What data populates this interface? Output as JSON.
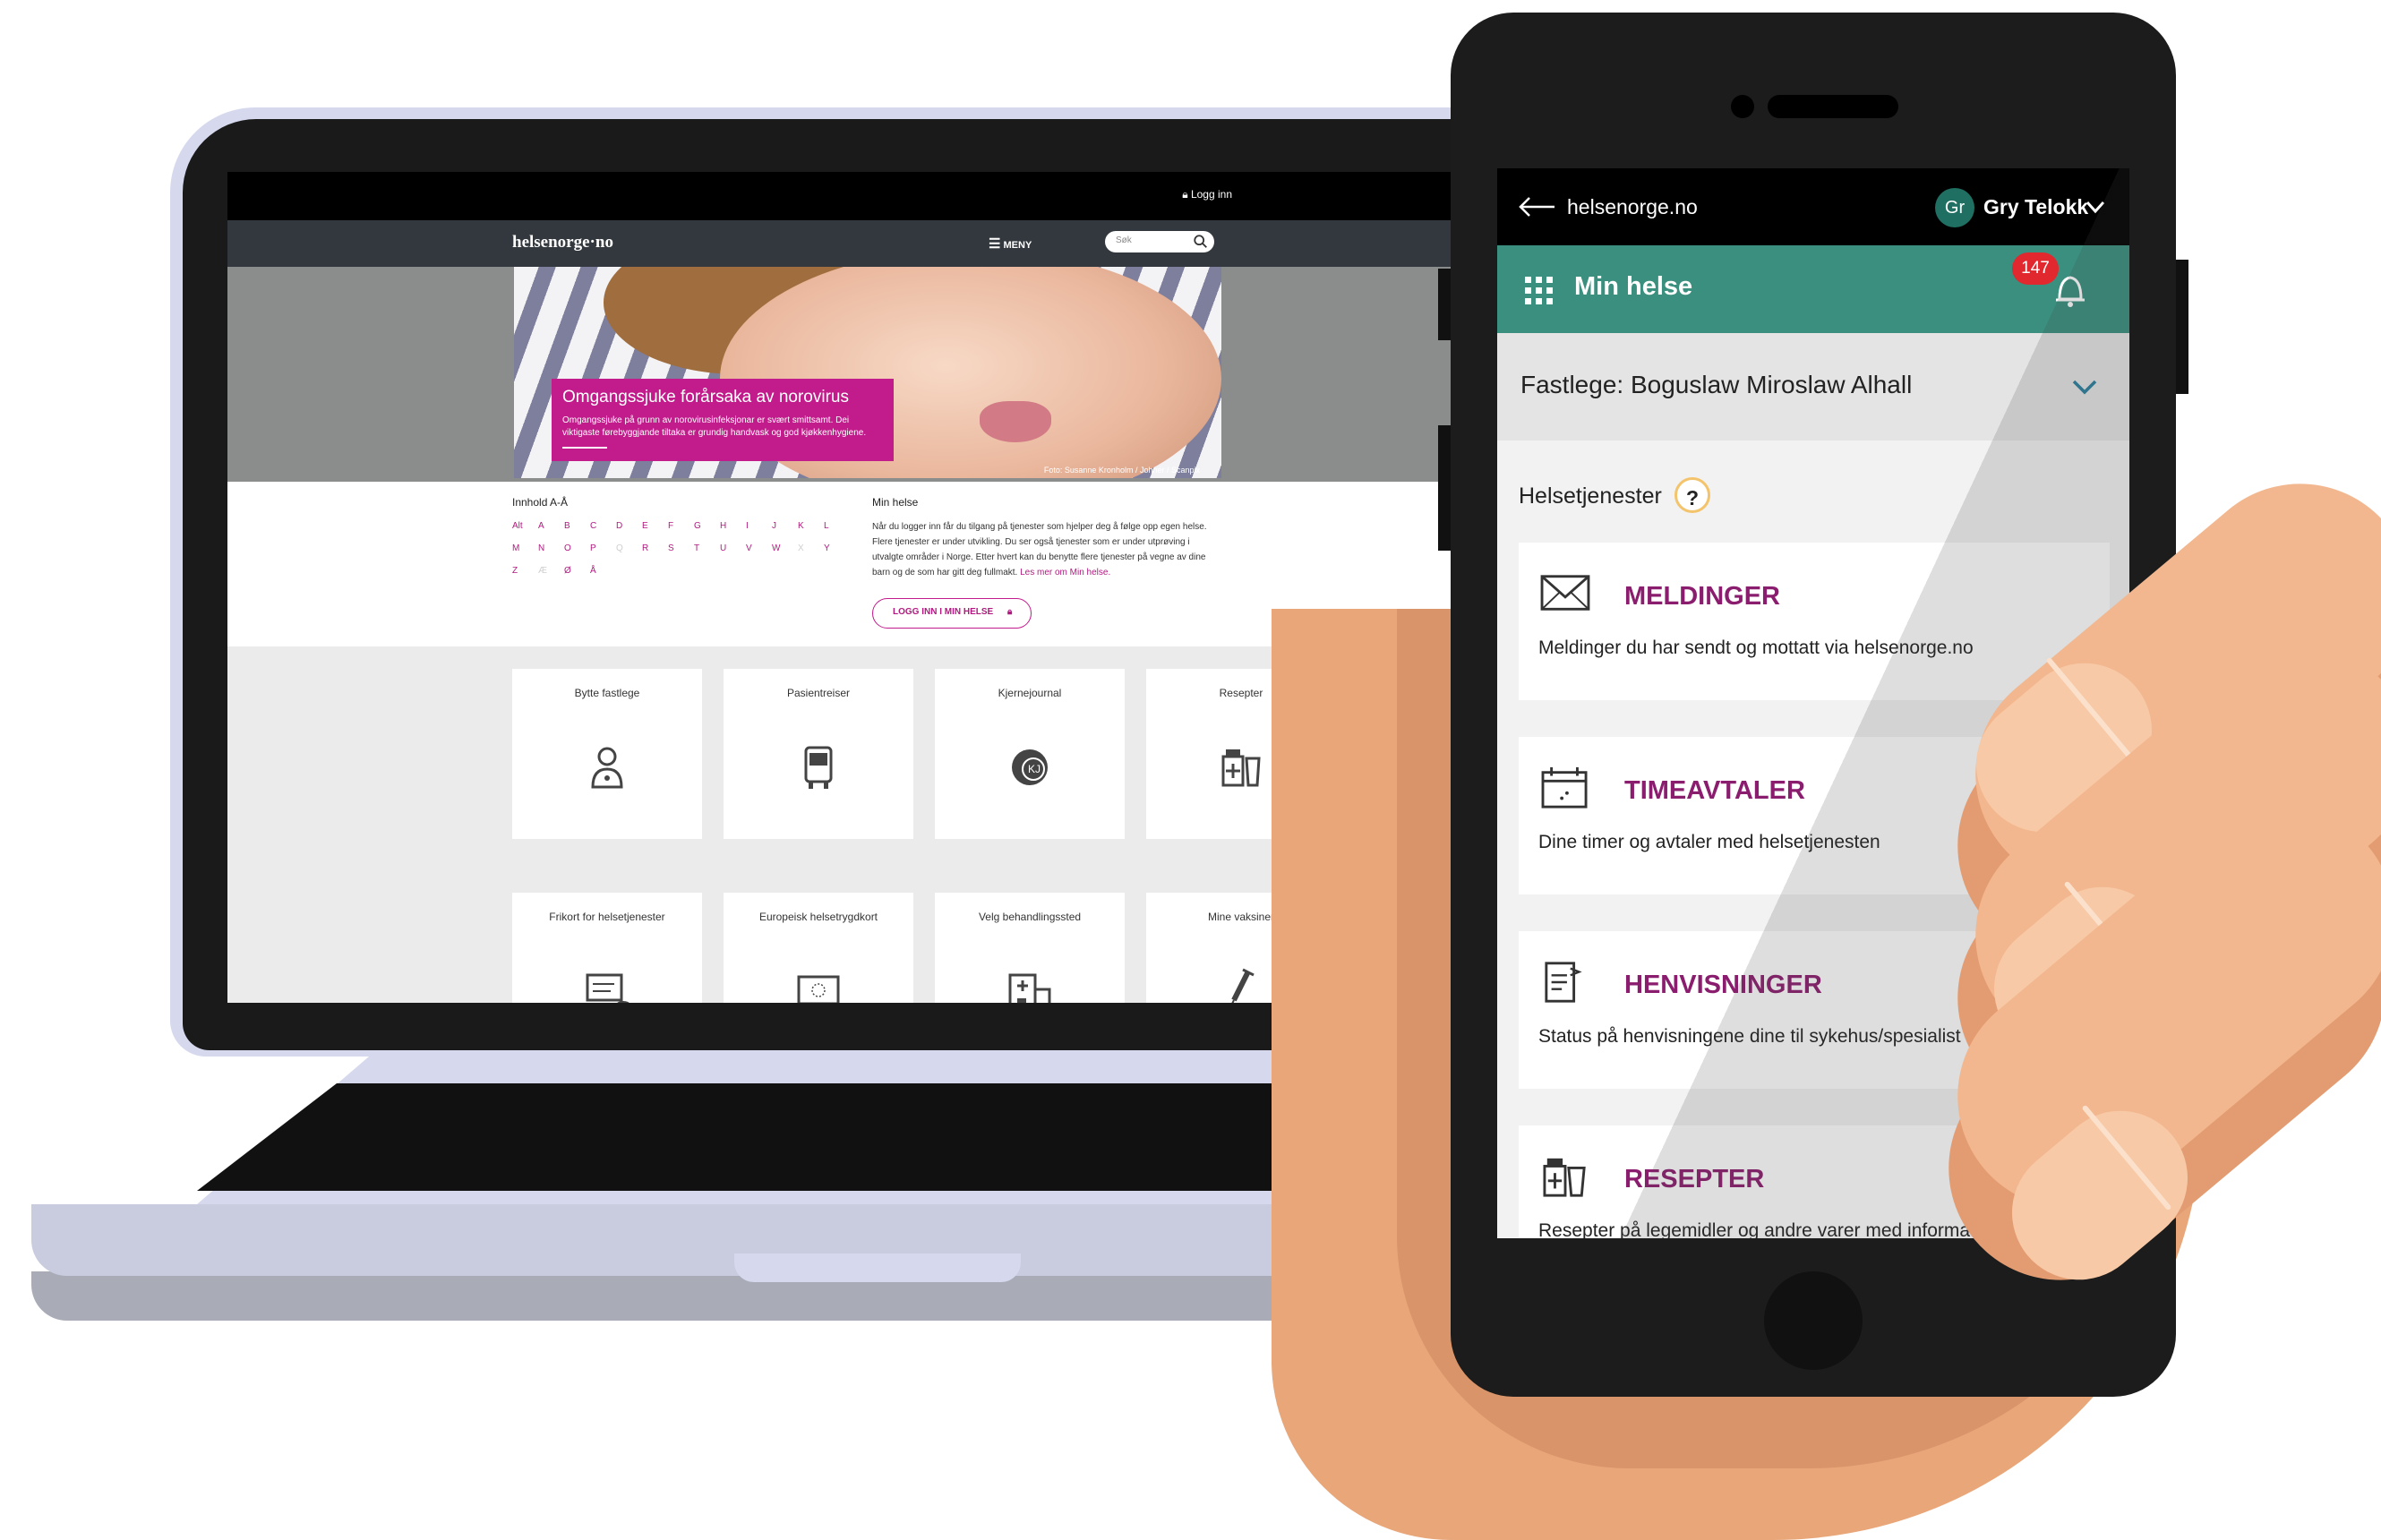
{
  "laptop": {
    "topbar": {
      "login": "Logg inn"
    },
    "navbar": {
      "logo": "helsenorge·no",
      "menu": "MENY",
      "search_placeholder": "Søk"
    },
    "hero": {
      "title": "Omgangssjuke forårsaka av norovirus",
      "text": "Omgangssjuke på grunn av norovirusinfeksjonar er svært smittsamt. Dei viktigaste førebyggjande tiltaka er grundig handvask og god kjøkkenhygiene.",
      "credit": "Foto: Susanne Kronholm / Johnér / Scanpix"
    },
    "az": {
      "heading": "Innhold A-Å",
      "rows": [
        [
          "Alt",
          "A",
          "B",
          "C",
          "D",
          "E",
          "F",
          "G",
          "H",
          "I",
          "J",
          "K",
          "L"
        ],
        [
          "M",
          "N",
          "O",
          "P",
          "Q",
          "R",
          "S",
          "T",
          "U",
          "V",
          "W",
          "X",
          "Y"
        ],
        [
          "Z",
          "Æ",
          "Ø",
          "Å"
        ]
      ],
      "disabled": [
        "Q",
        "X",
        "Æ"
      ]
    },
    "minhelse": {
      "heading": "Min helse",
      "text": "Når du logger inn får du tilgang på tjenester som hjelper deg å følge opp egen helse. Flere tjenester er under utvikling. Du ser også tjenester som er under utprøving i utvalgte områder i Norge. Etter hvert kan du benytte flere tjenester på vegne av dine barn og de som har gitt deg fullmakt.",
      "link": "Les mer om Min helse.",
      "button": "LOGG INN I MIN HELSE"
    },
    "tiles": [
      {
        "label": "Bytte fastlege",
        "icon": "doctor-icon"
      },
      {
        "label": "Pasientreiser",
        "icon": "bus-icon"
      },
      {
        "label": "Kjernejournal",
        "icon": "journal-icon"
      },
      {
        "label": "Resepter",
        "icon": "prescription-icon"
      },
      {
        "label": "Frikort for helsetjenester",
        "icon": "card-icon"
      },
      {
        "label": "Europeisk helsetrygdkort",
        "icon": "eu-card-icon"
      },
      {
        "label": "Velg behandlingssted",
        "icon": "hospital-icon"
      },
      {
        "label": "Mine vaksiner",
        "icon": "syringe-icon"
      }
    ]
  },
  "phone": {
    "topbar": {
      "site": "helsenorge.no",
      "avatar": "Gr",
      "user": "Gry Telokk"
    },
    "header": {
      "title": "Min helse",
      "badge": "147"
    },
    "fastlege": "Fastlege: Boguslaw Miroslaw Alhall",
    "services_label": "Helsetjenester",
    "help": "?",
    "cards": [
      {
        "title": "MELDINGER",
        "desc": "Meldinger du har sendt og mottatt via helsenorge.no",
        "icon": "envelope-icon"
      },
      {
        "title": "TIMEAVTALER",
        "desc": "Dine timer og avtaler med helsetjenesten",
        "icon": "calendar-icon"
      },
      {
        "title": "HENVISNINGER",
        "desc": "Status på henvisningene dine til sykehus/spesialist",
        "icon": "referral-icon"
      },
      {
        "title": "RESEPTER",
        "desc": "Resepter på legemidler og andre varer med informasjon om utleveringer og riktig bruk",
        "icon": "prescription-icon"
      }
    ]
  },
  "colors": {
    "brand_pink": "#c21b8b",
    "brand_teal": "#3a8f7e",
    "card_title": "#8b1d6e",
    "badge": "#e0282e"
  }
}
